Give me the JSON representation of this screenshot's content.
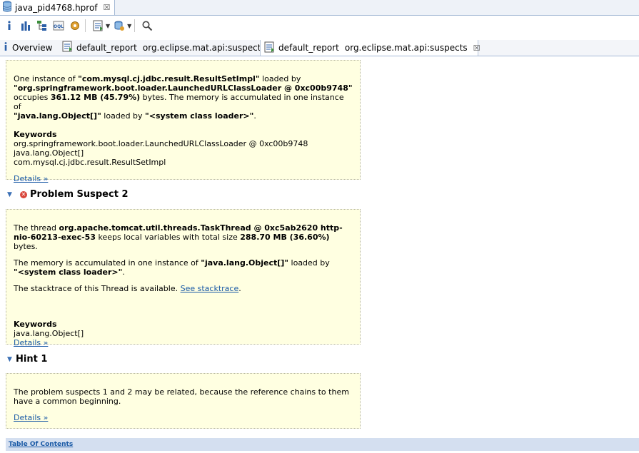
{
  "editor_tab": {
    "title": "java_pid4768.hprof",
    "close": "☒"
  },
  "report_tabs": [
    {
      "label": "Overview"
    },
    {
      "label": "default_report",
      "sublabel": "org.eclipse.mat.api:suspects"
    },
    {
      "label": "default_report",
      "sublabel": "org.eclipse.mat.api:suspects",
      "close": "☒"
    }
  ],
  "suspect1": {
    "t1": "One instance of ",
    "t2": "\"com.mysql.cj.jdbc.result.ResultSetImpl\"",
    "t3": " loaded by ",
    "t4": "\"org.springframework.boot.loader.LaunchedURLClassLoader @ 0xc00b9748\"",
    "t5": "occupies ",
    "t6": "361.12 MB (45.79%)",
    "t7": " bytes. The memory is accumulated in one instance of ",
    "t8": "\"java.lang.Object[]\"",
    "t9": " loaded by ",
    "t10": "\"<system class loader>\"",
    "t11": ".",
    "keywords_title": "Keywords",
    "keywords": [
      "org.springframework.boot.loader.LaunchedURLClassLoader @ 0xc00b9748",
      "java.lang.Object[]",
      "com.mysql.cj.jdbc.result.ResultSetImpl"
    ],
    "details": "Details »"
  },
  "suspect2_heading": "Problem Suspect 2",
  "suspect2": {
    "p1a": "The thread ",
    "p1b": "org.apache.tomcat.util.threads.TaskThread @ 0xc5ab2620 http-nio-60213-exec-53",
    "p1c": " keeps local variables with total size ",
    "p1d": "288.70 MB (36.60%)",
    "p1e": " bytes.",
    "p2a": "The memory is accumulated in one instance of ",
    "p2b": "\"java.lang.Object[]\"",
    "p2c": " loaded by",
    "p2d": "\"<system class loader>\"",
    "p2e": ".",
    "p3a": "The stacktrace of this Thread is available. ",
    "p3b": "See stacktrace",
    "p3c": ".",
    "keywords_title": "Keywords",
    "keywords": [
      "java.lang.Object[]"
    ],
    "details": "Details »"
  },
  "hint_heading": "Hint 1",
  "hint": {
    "text": "The problem suspects 1 and 2 may be related, because the reference chains to them have a common beginning.",
    "details": "Details »"
  },
  "toc": "Table Of Contents",
  "icons": {
    "hprof": "heap-dump-icon",
    "info": "info-icon",
    "histogram": "histogram-icon",
    "dominator": "dominator-tree-icon",
    "oql": "oql-icon",
    "gear": "gear-icon",
    "report": "report-icon",
    "query": "query-browser-icon",
    "search": "search-icon",
    "error": "error-icon"
  },
  "colors": {
    "panel_bg": "#ffffe1",
    "link": "#1a5aa6",
    "toc_bg": "#d4dff0",
    "tab_border": "#a6bad6"
  }
}
